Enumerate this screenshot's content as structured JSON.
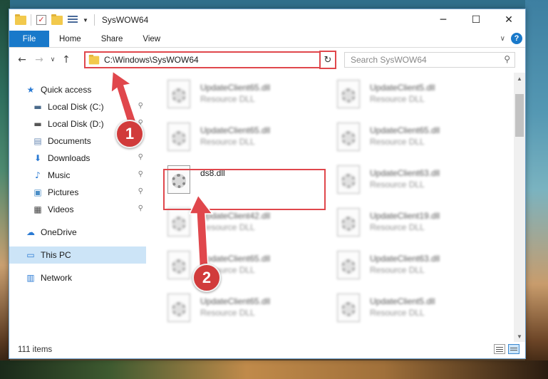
{
  "window": {
    "title": "SysWOW64",
    "controls": {
      "minimize": "─",
      "maximize": "☐",
      "close": "✕"
    }
  },
  "ribbon": {
    "tabs": [
      "File",
      "Home",
      "Share",
      "View"
    ],
    "help": "?"
  },
  "nav": {
    "back": "←",
    "forward": "→",
    "recent": "∨",
    "up": "↑",
    "address": "C:\\Windows\\SysWOW64",
    "refresh": "↻",
    "search_placeholder": "Search SysWOW64",
    "search_icon": "⚲"
  },
  "sidebar": {
    "items": [
      {
        "label": "Quick access",
        "icon": "star-icon",
        "glyph": "★",
        "color": "#2a7ad3",
        "pinned": false,
        "sub": false
      },
      {
        "label": "Local Disk (C:)",
        "icon": "drive-icon",
        "glyph": "▬",
        "color": "#4a6a8a",
        "pinned": true,
        "sub": true
      },
      {
        "label": "Local Disk (D:)",
        "icon": "drive-icon",
        "glyph": "▬",
        "color": "#555555",
        "pinned": true,
        "sub": true
      },
      {
        "label": "Documents",
        "icon": "documents-icon",
        "glyph": "▤",
        "color": "#6b8bb5",
        "pinned": true,
        "sub": true
      },
      {
        "label": "Downloads",
        "icon": "downloads-icon",
        "glyph": "⬇",
        "color": "#2a7ad3",
        "pinned": true,
        "sub": true
      },
      {
        "label": "Music",
        "icon": "music-icon",
        "glyph": "♪",
        "color": "#2a7ad3",
        "pinned": true,
        "sub": true
      },
      {
        "label": "Pictures",
        "icon": "pictures-icon",
        "glyph": "▣",
        "color": "#4b8ec6",
        "pinned": true,
        "sub": true
      },
      {
        "label": "Videos",
        "icon": "videos-icon",
        "glyph": "▦",
        "color": "#444444",
        "pinned": true,
        "sub": true
      },
      {
        "label": "OneDrive",
        "icon": "onedrive-icon",
        "glyph": "☁",
        "color": "#2a7ad3",
        "pinned": false,
        "sub": false
      },
      {
        "label": "This PC",
        "icon": "this-pc-icon",
        "glyph": "▭",
        "color": "#2a7ad3",
        "pinned": false,
        "sub": false
      },
      {
        "label": "Network",
        "icon": "network-icon",
        "glyph": "▥",
        "color": "#2a7ad3",
        "pinned": false,
        "sub": false
      }
    ],
    "pin_glyph": "⚲"
  },
  "files": [
    {
      "name": "UpdateClient65.dll",
      "type": "Resource DLL",
      "blurred": true
    },
    {
      "name": "UpdateClient5.dll",
      "type": "Resource DLL",
      "blurred": true
    },
    {
      "name": "UpdateClient65.dll",
      "type": "Resource DLL",
      "blurred": true
    },
    {
      "name": "UpdateClient65.dll",
      "type": "Resource DLL",
      "blurred": true
    },
    {
      "name": "ds8.dll",
      "type": "",
      "blurred": false
    },
    {
      "name": "UpdateClient63.dll",
      "type": "Resource DLL",
      "blurred": true
    },
    {
      "name": "UpdateClient42.dll",
      "type": "Resource DLL",
      "blurred": true
    },
    {
      "name": "UpdateClient19.dll",
      "type": "Resource DLL",
      "blurred": true
    },
    {
      "name": "UpdateClient65.dll",
      "type": "Resource DLL",
      "blurred": true
    },
    {
      "name": "UpdateClient63.dll",
      "type": "Resource DLL",
      "blurred": true
    },
    {
      "name": "UpdateClient65.dll",
      "type": "Resource DLL",
      "blurred": true
    },
    {
      "name": "UpdateClient5.dll",
      "type": "Resource DLL",
      "blurred": true
    }
  ],
  "status": {
    "items": "111 items"
  },
  "annotations": {
    "step1": "1",
    "step2": "2",
    "color": "#d13b3b"
  }
}
